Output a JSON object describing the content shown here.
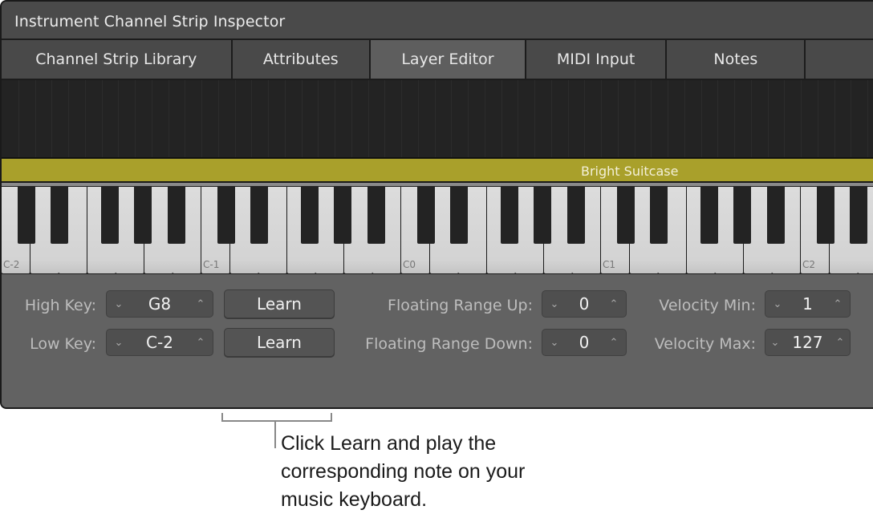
{
  "window": {
    "title": "Instrument Channel Strip Inspector"
  },
  "tabs": [
    {
      "label": "Channel Strip Library",
      "active": false
    },
    {
      "label": "Attributes",
      "active": false
    },
    {
      "label": "Layer Editor",
      "active": true
    },
    {
      "label": "MIDI Input",
      "active": false
    },
    {
      "label": "Notes",
      "active": false
    },
    {
      "label": "",
      "active": false
    }
  ],
  "layer": {
    "name": "Bright Suitcase",
    "color": "#a9a02b"
  },
  "keyboard": {
    "octave_labels": [
      "C-2",
      "C-1",
      "C0",
      "C1",
      "C2"
    ]
  },
  "controls": {
    "high_key": {
      "label": "High Key:",
      "value": "G8",
      "learn": "Learn"
    },
    "low_key": {
      "label": "Low Key:",
      "value": "C-2",
      "learn": "Learn"
    },
    "floating_up": {
      "label": "Floating Range Up:",
      "value": "0"
    },
    "floating_down": {
      "label": "Floating Range Down:",
      "value": "0"
    },
    "velocity_min": {
      "label": "Velocity Min:",
      "value": "1"
    },
    "velocity_max": {
      "label": "Velocity Max:",
      "value": "127"
    },
    "decrement_glyph": "⌄",
    "increment_glyph": "⌃"
  },
  "callout": {
    "text": "Click Learn and play the corresponding note on your music keyboard."
  }
}
